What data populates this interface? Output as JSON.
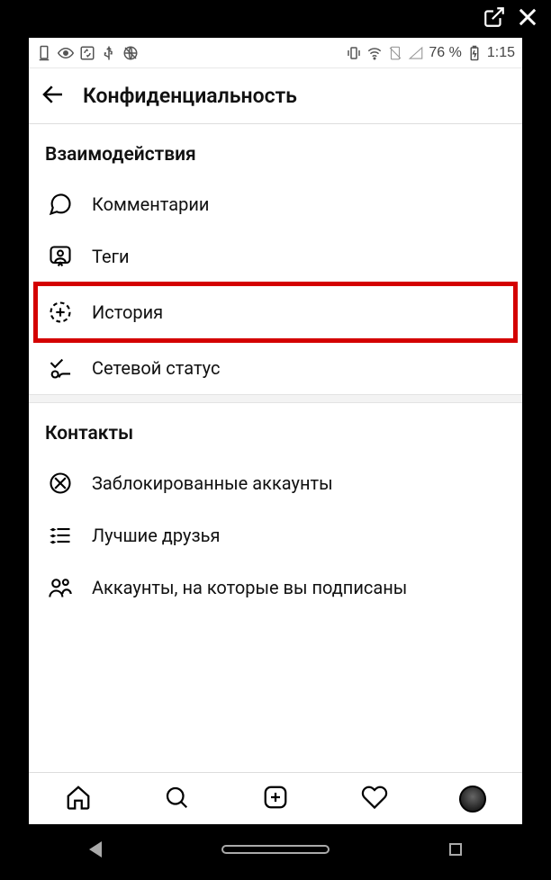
{
  "statusbar": {
    "battery_pct": "76 %",
    "time": "1:15"
  },
  "header": {
    "title": "Конфиденциальность"
  },
  "sections": [
    {
      "title": "Взаимодействия",
      "items": [
        {
          "label": "Комментарии"
        },
        {
          "label": "Теги"
        },
        {
          "label": "История"
        },
        {
          "label": "Сетевой статус"
        }
      ]
    },
    {
      "title": "Контакты",
      "items": [
        {
          "label": "Заблокированные аккаунты"
        },
        {
          "label": "Лучшие друзья"
        },
        {
          "label": "Аккаунты, на которые вы подписаны"
        }
      ]
    }
  ]
}
